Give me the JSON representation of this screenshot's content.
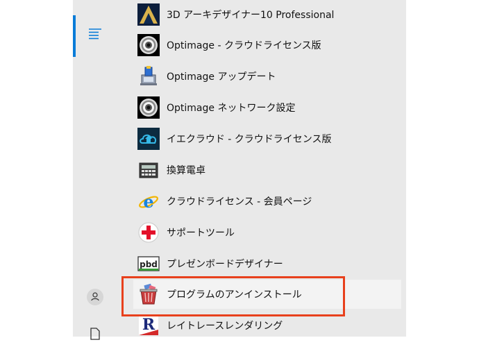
{
  "start_menu": {
    "apps": [
      {
        "label": "3D アーキデザイナー10 Professional",
        "icon": "3d-architect-icon"
      },
      {
        "label": "Optimage - クラウドライセンス版",
        "icon": "optimage-lens-icon"
      },
      {
        "label": "Optimage アップデート",
        "icon": "update-installer-icon"
      },
      {
        "label": "Optimage ネットワーク設定",
        "icon": "optimage-lens-icon"
      },
      {
        "label": "イエクラウド - クラウドライセンス版",
        "icon": "iecloud-icon"
      },
      {
        "label": "換算電卓",
        "icon": "calculator-icon"
      },
      {
        "label": "クラウドライセンス - 会員ページ",
        "icon": "internet-explorer-icon"
      },
      {
        "label": "サポートツール",
        "icon": "support-cross-icon"
      },
      {
        "label": "プレゼンボードデザイナー",
        "icon": "pbd-icon"
      },
      {
        "label": "プログラムのアンインストール",
        "icon": "uninstall-trash-icon"
      },
      {
        "label": "レイトレースレンダリング",
        "icon": "raytrace-icon"
      }
    ]
  },
  "colors": {
    "highlight_border": "#e8401c",
    "accent": "#0a7cd8"
  }
}
